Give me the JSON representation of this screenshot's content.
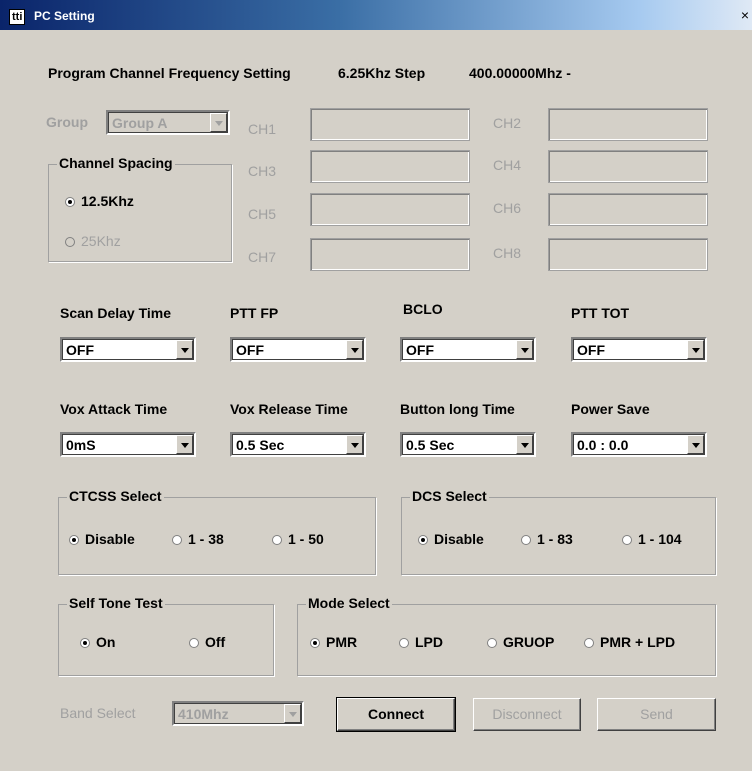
{
  "window": {
    "icon_text": "tti",
    "title": "PC Setting",
    "close_glyph": "×"
  },
  "header": {
    "label": "Program Channel Frequency Setting",
    "step": "6.25Khz Step",
    "frequency": "400.00000Mhz -"
  },
  "group": {
    "label": "Group",
    "value": "Group A"
  },
  "channels": [
    "CH1",
    "CH2",
    "CH3",
    "CH4",
    "CH5",
    "CH6",
    "CH7",
    "CH8"
  ],
  "channel_spacing": {
    "title": "Channel Spacing",
    "options": [
      "12.5Khz",
      "25Khz"
    ],
    "selected": "12.5Khz"
  },
  "settings_row1": [
    {
      "label": "Scan Delay Time",
      "value": "OFF"
    },
    {
      "label": "PTT FP",
      "value": "OFF"
    },
    {
      "label": "BCLO",
      "value": "OFF"
    },
    {
      "label": "PTT TOT",
      "value": "OFF"
    }
  ],
  "settings_row2": [
    {
      "label": "Vox Attack Time",
      "value": "0mS"
    },
    {
      "label": "Vox Release Time",
      "value": "0.5 Sec"
    },
    {
      "label": "Button long Time",
      "value": "0.5 Sec"
    },
    {
      "label": "Power Save",
      "value": "0.0 : 0.0"
    }
  ],
  "ctcss": {
    "title": "CTCSS Select",
    "options": [
      "Disable",
      "1 - 38",
      "1 - 50"
    ],
    "selected": "Disable"
  },
  "dcs": {
    "title": "DCS Select",
    "options": [
      "Disable",
      "1 - 83",
      "1 - 104"
    ],
    "selected": "Disable"
  },
  "self_tone": {
    "title": "Self Tone Test",
    "options": [
      "On",
      "Off"
    ],
    "selected": "On"
  },
  "mode": {
    "title": "Mode Select",
    "options": [
      "PMR",
      "LPD",
      "GRUOP",
      "PMR + LPD"
    ],
    "selected": "PMR"
  },
  "band": {
    "label": "Band Select",
    "value": "410Mhz"
  },
  "buttons": {
    "connect": "Connect",
    "disconnect": "Disconnect",
    "send": "Send"
  },
  "colors": {
    "face": "#d4d0c8",
    "disabled_text": "#a0a0a0",
    "title_bar": "#0a246a"
  }
}
